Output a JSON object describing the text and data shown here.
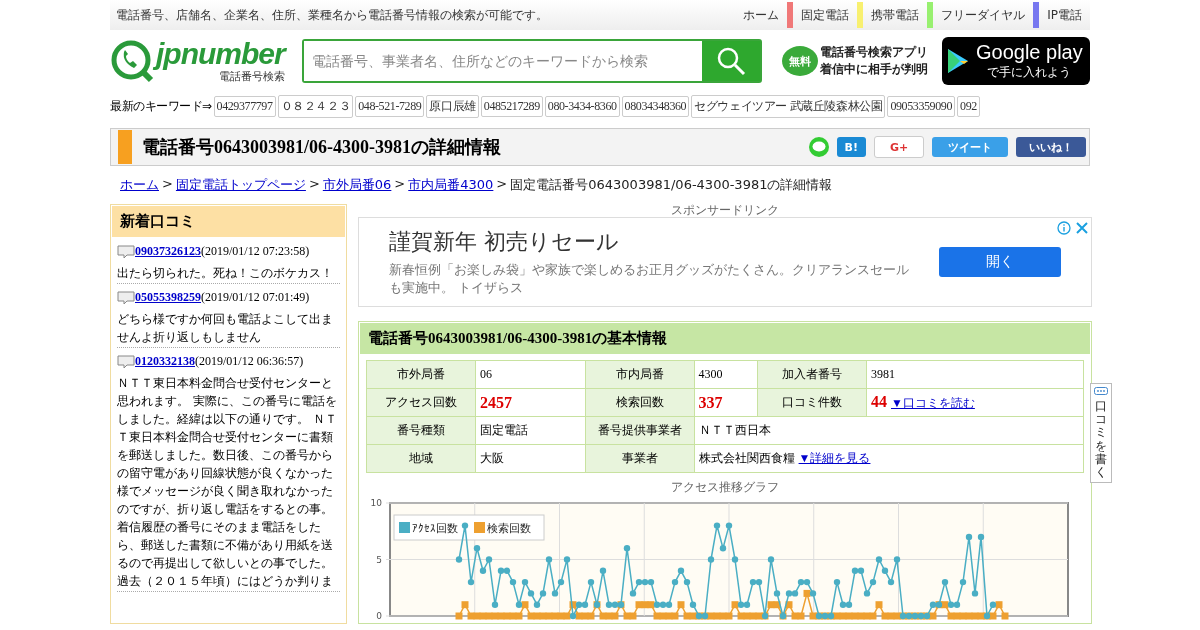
{
  "top_bar": {
    "tagline": "電話番号、店舗名、企業名、住所、業種名から電話番号情報の検索が可能です。",
    "nav": [
      {
        "label": "ホーム"
      },
      {
        "label": "固定電話",
        "color": "#f07878"
      },
      {
        "label": "携帯電話",
        "color": "#f8f070"
      },
      {
        "label": "フリーダイヤル",
        "color": "#98f070"
      },
      {
        "label": "IP電話",
        "color": "#7878f0"
      }
    ]
  },
  "logo": {
    "name": "jpnumber",
    "subtitle": "電話番号検索"
  },
  "search": {
    "placeholder": "電話番号、事業者名、住所などのキーワードから検索"
  },
  "app_promo": {
    "badge": "無料",
    "line_1": "電話番号検索アプリ",
    "line_2": "着信中に相手が判明"
  },
  "store_badge": {
    "title": "Google play",
    "subtitle": "で手に入れよう"
  },
  "keywords": {
    "label": "最新のキーワード⇒",
    "items": [
      "0429377797",
      "０８２４２３",
      "048-521-7289",
      "原口辰雄",
      "0485217289",
      "080-3434-8360",
      "08034348360",
      "セグウェイツアー 武蔵丘陵森林公園",
      "09053359090",
      "092"
    ]
  },
  "page_title": "電話番号0643003981/06-4300-3981の詳細情報",
  "share_buttons": [
    {
      "kind": "line"
    },
    {
      "kind": "hatena",
      "label": "B!"
    },
    {
      "kind": "google",
      "label": "G+"
    },
    {
      "kind": "twitter",
      "label": "ツイート"
    },
    {
      "kind": "facebook",
      "label": "いいね！"
    }
  ],
  "breadcrumb": [
    {
      "text": "ホーム",
      "link": true
    },
    {
      "text": ">",
      "link": false
    },
    {
      "text": "固定電話トップページ",
      "link": true
    },
    {
      "text": ">",
      "link": false
    },
    {
      "text": "市外局番06",
      "link": true
    },
    {
      "text": ">",
      "link": false
    },
    {
      "text": "市内局番4300",
      "link": true
    },
    {
      "text": ">",
      "link": false
    },
    {
      "text": "固定電話番号0643003981/06-4300-3981の詳細情報",
      "link": false
    }
  ],
  "reviews": {
    "title": "新着口コミ",
    "items": [
      {
        "number": "09037326123",
        "date": "(2019/01/12 07:23:58)",
        "text": "出たら切られた。死ね！このボケカス！"
      },
      {
        "number": "05055398259",
        "date": "(2019/01/12 07:01:49)",
        "text": "どちら様ですか何回も電話よこして出ませんよ折り返しもしません"
      },
      {
        "number": "0120332138",
        "date": "(2019/01/12 06:36:57)",
        "text": "ＮＴＴ東日本料金問合せ受付センターと思われます。 実際に、この番号に電話をしました。経緯は以下の通りです。 ＮＴＴ東日本料金問合せ受付センターに書類を郵送しました。数日後、この番号からの留守電があり回線状態が良くなかった様でメッセージが良く聞き取れなかったのですが、折り返し電話をするとの事。着信履歴の番号にそのまま電話をしたら、郵送した書類に不備があり用紙を送るので再提出して欲しいとの事でした。過去（２０１５年頃）にはどうか判りま"
      }
    ]
  },
  "ad": {
    "label": "スポンサードリンク",
    "headline": "謹賀新年 初売りセール",
    "body": "新春恒例「お楽しみ袋」や家族で楽しめるお正月グッズがたくさん。クリアランスセールも実施中。 トイザらス",
    "button": "開く"
  },
  "basic_info": {
    "title": "電話番号0643003981/06-4300-3981の基本情報",
    "rows": [
      [
        {
          "kind": "label",
          "text": "市外局番"
        },
        {
          "kind": "value",
          "text": "06"
        },
        {
          "kind": "label",
          "text": "市内局番"
        },
        {
          "kind": "value",
          "text": "4300"
        },
        {
          "kind": "label",
          "text": "加入者番号"
        },
        {
          "kind": "value",
          "text": "3981"
        }
      ],
      [
        {
          "kind": "label",
          "text": "アクセス回数"
        },
        {
          "kind": "count",
          "text": "2457"
        },
        {
          "kind": "label",
          "text": "検索回数"
        },
        {
          "kind": "count",
          "text": "337"
        },
        {
          "kind": "label",
          "text": "口コミ件数"
        },
        {
          "kind": "count",
          "text": "44",
          "link": "▼口コミを読む"
        }
      ],
      [
        {
          "kind": "label",
          "text": "番号種類"
        },
        {
          "kind": "value",
          "text": "固定電話"
        },
        {
          "kind": "label",
          "text": "番号提供事業者"
        },
        {
          "kind": "value",
          "text": "ＮＴＴ西日本",
          "colspan": 3
        }
      ],
      [
        {
          "kind": "label",
          "text": "地域"
        },
        {
          "kind": "value",
          "text": "大阪"
        },
        {
          "kind": "label",
          "text": "事業者"
        },
        {
          "kind": "value",
          "text": "株式会社関西食糧",
          "link": "▼詳細を見る",
          "colspan": 3
        }
      ]
    ]
  },
  "chart": {
    "chart_data": {
      "type": "line",
      "title": "アクセス推移グラフ",
      "legend": "upper left",
      "ylim": [
        0,
        10
      ],
      "yticks": [
        0,
        5,
        10
      ],
      "series": [
        {
          "name": "ｱｸｾｽ回数",
          "color": "#4aaec4",
          "marker": "circle",
          "values": [
            null,
            null,
            null,
            null,
            null,
            null,
            null,
            null,
            null,
            null,
            null,
            5,
            8,
            3,
            6,
            4,
            5,
            1,
            4,
            4,
            3,
            1,
            3,
            2,
            1,
            2,
            5,
            2,
            3,
            5,
            0,
            1,
            1,
            3,
            1,
            4,
            1,
            1,
            1,
            6,
            2,
            3,
            3,
            3,
            1,
            1,
            1,
            3,
            4,
            3,
            1,
            0,
            0,
            5,
            8,
            6,
            8,
            5,
            1,
            1,
            3,
            3,
            0,
            5,
            2,
            0,
            2,
            2,
            3,
            3,
            2,
            0,
            0,
            0,
            3,
            1,
            1,
            4,
            4,
            2,
            3,
            5,
            4,
            3,
            5,
            0,
            0,
            0,
            0,
            0,
            1,
            1,
            3,
            1,
            1,
            3,
            7,
            2,
            7,
            0,
            1,
            null,
            null,
            null,
            null,
            null,
            null,
            null,
            null,
            null,
            null,
            null,
            null
          ]
        },
        {
          "name": "検索回数",
          "color": "#eea030",
          "marker": "square",
          "values": [
            null,
            null,
            null,
            null,
            null,
            null,
            null,
            null,
            null,
            null,
            null,
            0,
            1,
            0,
            0,
            0,
            0,
            0,
            0,
            0,
            0,
            0,
            1,
            0,
            0,
            0,
            0,
            0,
            0,
            0,
            1,
            0,
            0,
            0,
            1,
            0,
            0,
            0,
            1,
            0,
            0,
            1,
            1,
            1,
            0,
            0,
            0,
            0,
            1,
            0,
            0,
            0,
            0,
            0,
            0,
            0,
            0,
            1,
            0,
            0,
            0,
            0,
            0,
            1,
            1,
            0,
            1,
            0,
            0,
            2,
            0,
            0,
            0,
            0,
            0,
            0,
            0,
            0,
            0,
            0,
            0,
            1,
            0,
            0,
            0,
            0,
            0,
            0,
            0,
            0,
            0,
            1,
            1,
            0,
            0,
            0,
            0,
            0,
            0,
            0,
            0,
            1,
            0,
            null,
            null,
            null,
            null,
            null,
            null,
            null,
            null,
            null,
            null,
            null,
            null
          ]
        }
      ]
    }
  },
  "side_tab": {
    "label": "口コミを書く"
  }
}
